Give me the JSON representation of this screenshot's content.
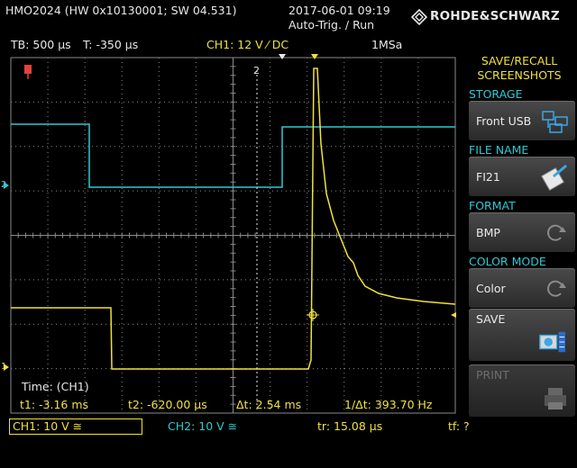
{
  "header": {
    "device": "HMO2024 (HW 0x10130001; SW 04.531)",
    "datetime": "2017-06-01 09:19",
    "trigger_state": "Auto-Trig. / Run",
    "brand": "ROHDE&SCHWARZ"
  },
  "status_bar": {
    "timebase": "TB: 500 µs",
    "trigger_time": "T: -350 µs",
    "channel_setting": "CH1: 12 V ⁄ DC",
    "sample_rate": "1MSa"
  },
  "markers": {
    "ch1_marker": "1",
    "ch2_marker": "2",
    "cursor2_label": "2",
    "trigger_marker_top": "T",
    "ch1_level": "1",
    "ch2_level": "2"
  },
  "measurement": {
    "title": "Time: (CH1)",
    "t1": "t1: -3.16 ms",
    "t2": "t2: -620.00 µs",
    "dt": "Δt: 2.54 ms",
    "inv_dt": "1/Δt: 393.70 Hz"
  },
  "bottom_bar": {
    "ch1": "CH1: 10 V ≅",
    "ch2": "CH2: 10 V ≅",
    "tr": "tr: 15.08 µs",
    "tf": "tf: ?"
  },
  "menu": {
    "title_line1": "SAVE/RECALL",
    "title_line2": "SCREENSHOTS",
    "storage_header": "STORAGE",
    "storage_value": "Front USB",
    "filename_header": "FILE NAME",
    "filename_value": "FI21",
    "format_header": "FORMAT",
    "format_value": "BMP",
    "colormode_header": "COLOR MODE",
    "colormode_value": "Color",
    "save_label": "SAVE",
    "print_label": "PRINT"
  },
  "colors": {
    "ch1": "#f0e13c",
    "ch2": "#2fc9d2",
    "grid": "#8a8a8a",
    "menu_header": "#f0e13c"
  },
  "icons": {
    "storage": "usb-folder-icon",
    "filename": "edit-file-icon",
    "format": "refresh-icon",
    "colormode": "refresh-icon",
    "save": "camera-save-icon",
    "print": "printer-icon"
  }
}
